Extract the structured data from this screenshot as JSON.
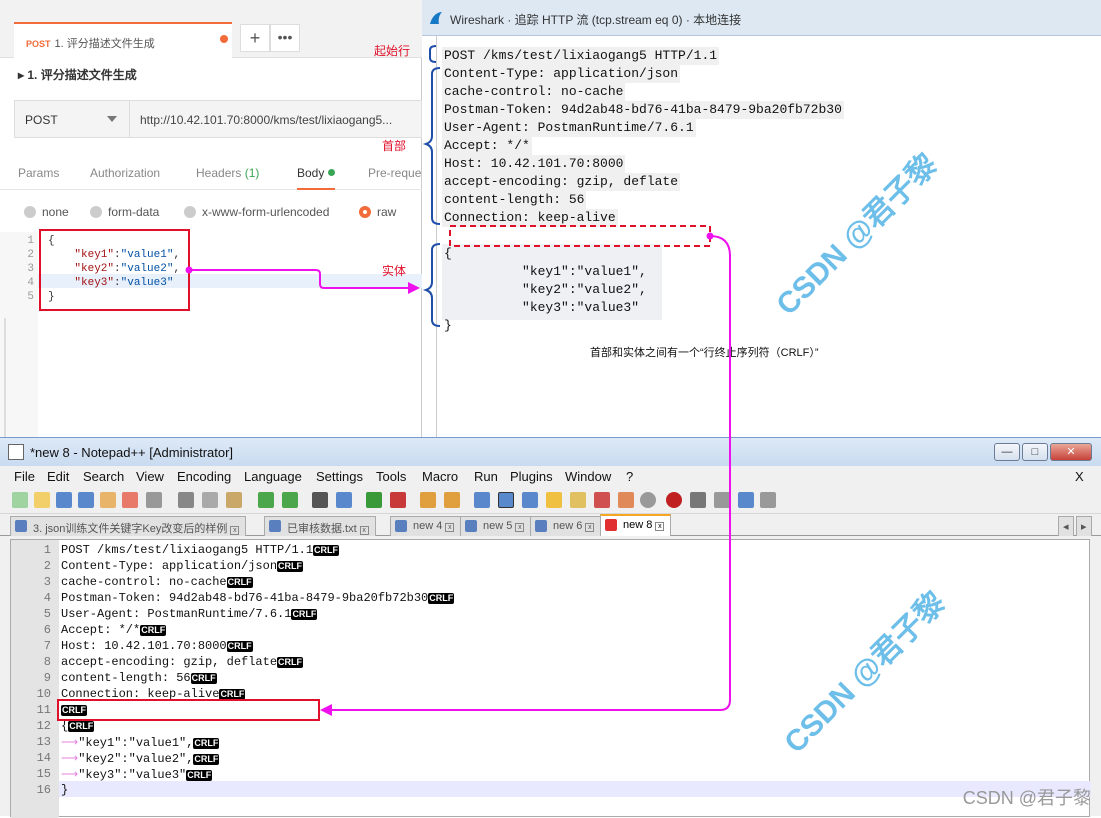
{
  "postman": {
    "tab": {
      "method": "POST",
      "title": "1. 评分描述文件生成"
    },
    "breadcrumb": "▸ 1. 评分描述文件生成",
    "method": "POST",
    "url": "http://10.42.101.70:8000/kms/test/lixiaogang5...",
    "req_tabs": [
      "Params",
      "Authorization",
      "Headers",
      "(1)",
      "Body",
      "Pre-reque"
    ],
    "body_types": [
      "none",
      "form-data",
      "x-www-form-urlencoded",
      "raw"
    ],
    "code_lines": [
      "1",
      "2",
      "3",
      "4",
      "5"
    ],
    "code": {
      "open": "{",
      "k1": "\"key1\"",
      "v1": "\"value1\"",
      "k2": "\"key2\"",
      "v2": "\"value2\"",
      "k3": "\"key3\"",
      "v3": "\"value3\"",
      "close": "}"
    }
  },
  "wireshark": {
    "title": "Wireshark · 追踪 HTTP 流 (tcp.stream eq 0) · 本地连接",
    "lines": [
      "POST /kms/test/lixiaogang5 HTTP/1.1",
      "Content-Type: application/json",
      "cache-control: no-cache",
      "Postman-Token: 94d2ab48-bd76-41ba-8479-9ba20fb72b30",
      "User-Agent: PostmanRuntime/7.6.1",
      "Accept: */*",
      "Host: 10.42.101.70:8000",
      "accept-encoding: gzip, deflate",
      "content-length: 56",
      "Connection: keep-alive"
    ],
    "body": [
      "{",
      "          \"key1\":\"value1\",",
      "          \"key2\":\"value2\",",
      "          \"key3\":\"value3\"",
      "}"
    ]
  },
  "annotations": {
    "start_line": "起始行",
    "headers": "首部",
    "entity": "实体",
    "crlf_note": "首部和实体之间有一个“行终止序列符（CRLF）”",
    "watermark": "CSDN @君子黎"
  },
  "notepad": {
    "title": "*new 8 - Notepad++ [Administrator]",
    "menu": [
      "File",
      "Edit",
      "Search",
      "View",
      "Encoding",
      "Language",
      "Settings",
      "Tools",
      "Macro",
      "Run",
      "Plugins",
      "Window",
      "?"
    ],
    "close_x": "X",
    "tabs": [
      "3. json训练文件关键字Key改变后的样例",
      "已审核数据.txt",
      "new 4",
      "new 5",
      "new 6",
      "new 8"
    ],
    "line_numbers": [
      "1",
      "2",
      "3",
      "4",
      "5",
      "6",
      "7",
      "8",
      "9",
      "10",
      "11",
      "12",
      "13",
      "14",
      "15",
      "16"
    ],
    "lines": [
      "POST /kms/test/lixiaogang5 HTTP/1.1",
      "Content-Type: application/json",
      "cache-control: no-cache",
      "Postman-Token: 94d2ab48-bd76-41ba-8479-9ba20fb72b30",
      "User-Agent: PostmanRuntime/7.6.1",
      "Accept: */*",
      "Host: 10.42.101.70:8000",
      "accept-encoding: gzip, deflate",
      "content-length: 56",
      "Connection: keep-alive",
      "",
      "{",
      "\"key1\":\"value1\",",
      "\"key2\":\"value2\",",
      "\"key3\":\"value3\"",
      "}"
    ],
    "crlf_cr": "CR",
    "crlf_lf": "LF",
    "tab_arrow": "⟶"
  },
  "footer": "CSDN @君子黎",
  "colors": {
    "accent": "#f26b3a",
    "annotation_red": "#e0102a",
    "magenta": "#ee11ee",
    "watermark": "#54b4e6"
  }
}
